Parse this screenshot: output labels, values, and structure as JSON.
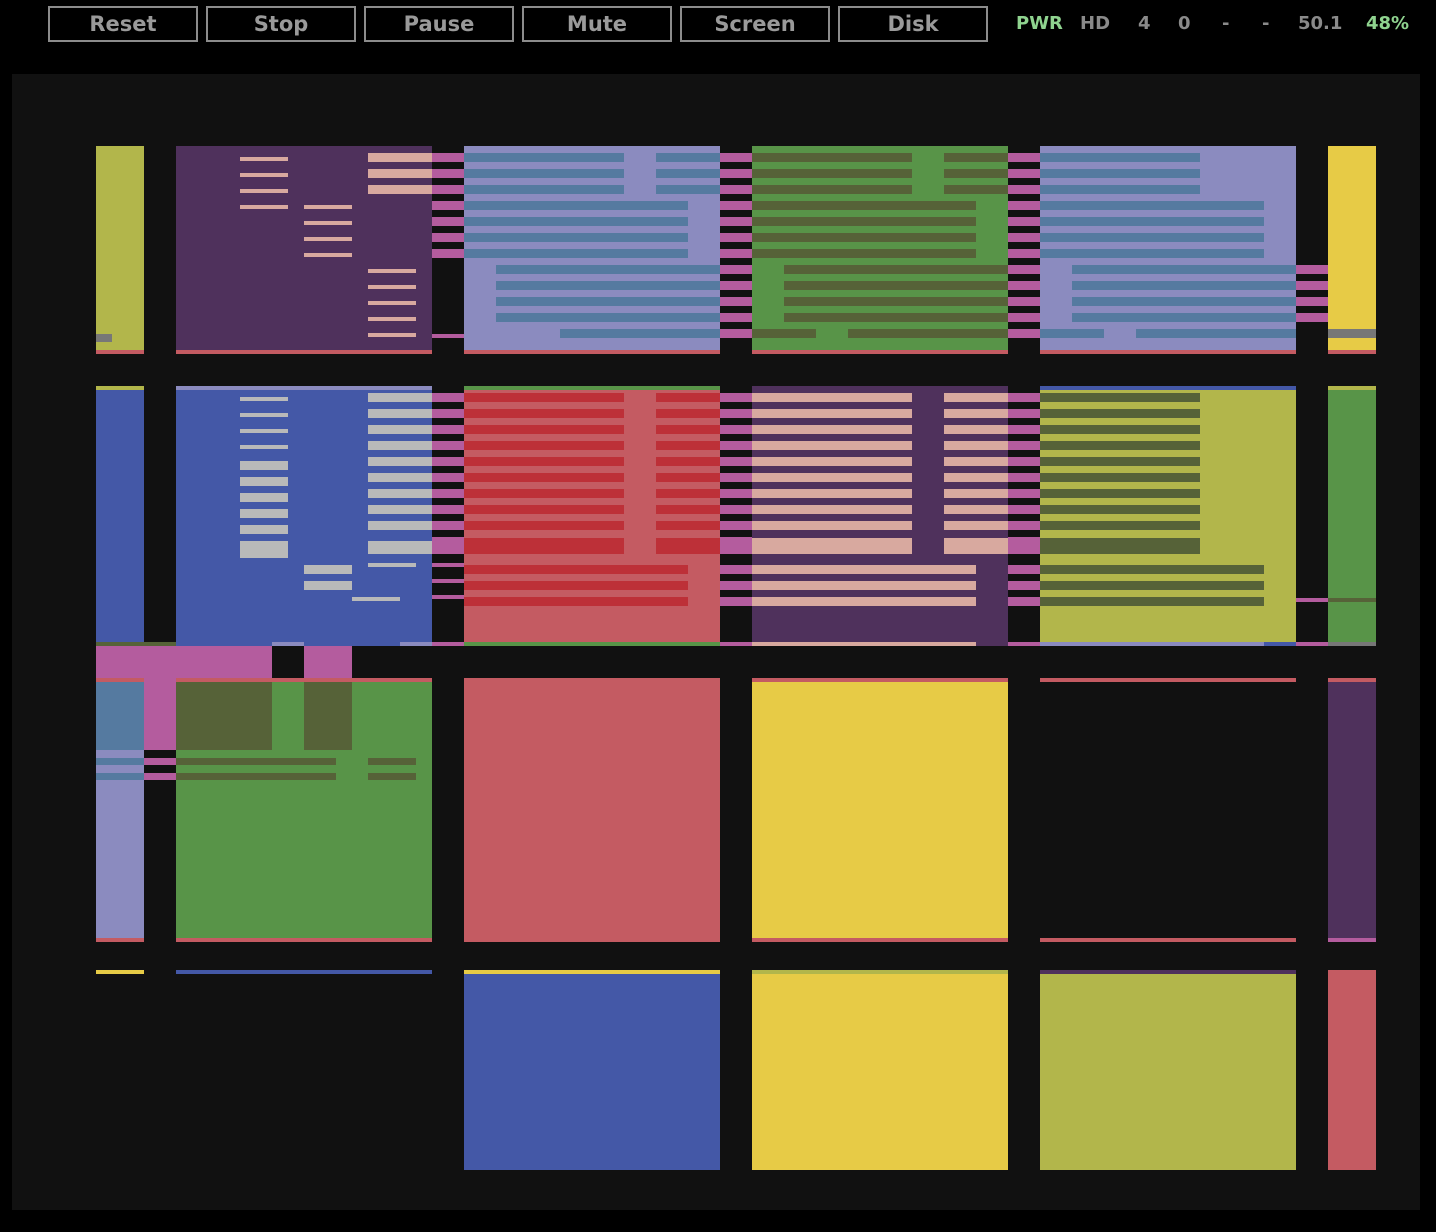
{
  "toolbar": {
    "buttons": [
      {
        "label": "Reset"
      },
      {
        "label": "Stop"
      },
      {
        "label": "Pause"
      },
      {
        "label": "Mute"
      },
      {
        "label": "Screen"
      },
      {
        "label": "Disk"
      }
    ]
  },
  "status": {
    "pwr": "PWR",
    "hd": "HD",
    "val_a": "4",
    "val_b": "0",
    "val_c": "-",
    "val_d": "-",
    "fps": "50.1",
    "speed": "48%",
    "pwr_color": "#8fd38f",
    "speed_color": "#8fd38f"
  },
  "palette": {
    "olive": "#b2b64b",
    "purple": "#4f315c",
    "lavender": "#8b8bbf",
    "green": "#589448",
    "yellow": "#e7cb46",
    "blue": "#4458a7",
    "red": "#c45b62",
    "magenta": "#b45c9e",
    "steel": "#557aa0",
    "dark_olive": "#566238",
    "peach": "#d8a99f",
    "gray": "#b9b9b9",
    "crimson": "#bd3038"
  }
}
